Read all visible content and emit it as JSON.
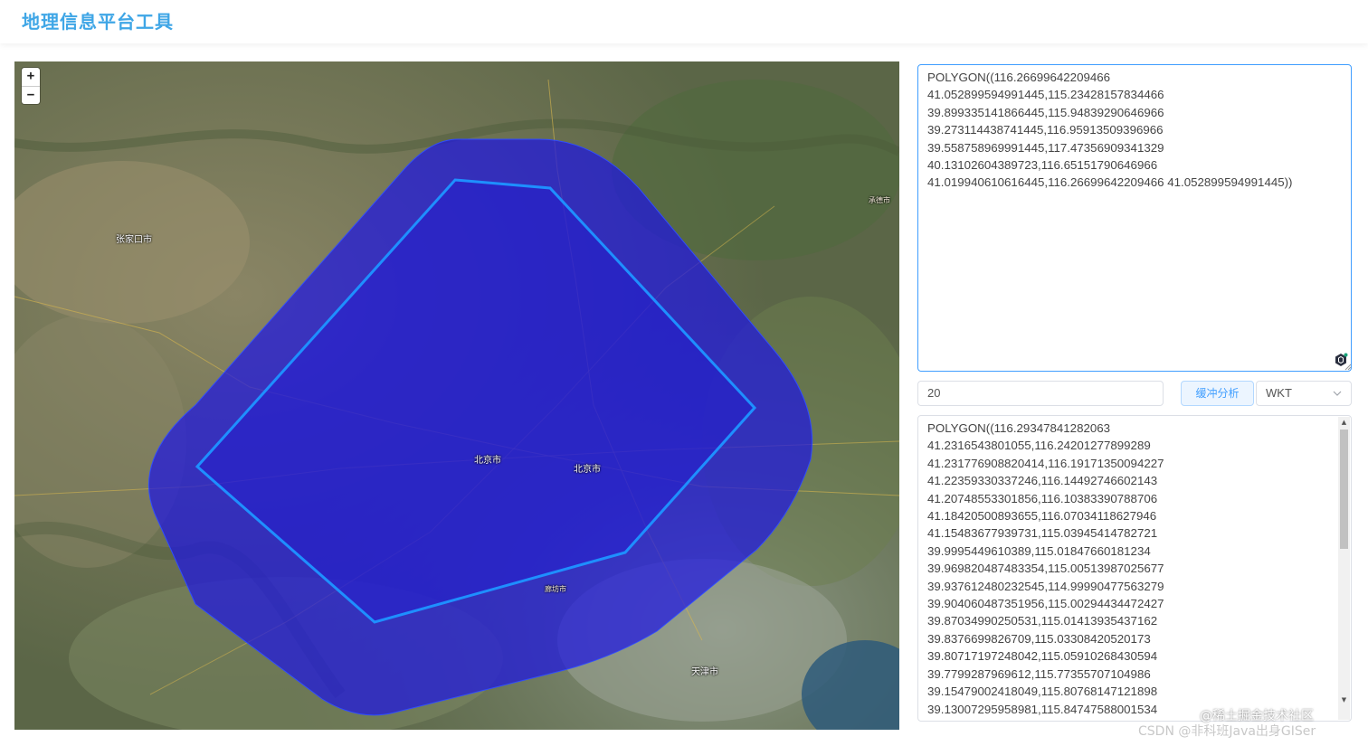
{
  "app": {
    "title": "地理信息平台工具"
  },
  "map": {
    "zoom_in_label": "+",
    "zoom_out_label": "−",
    "polygon_fill": "#1b12e6",
    "polygon_stroke": "#1e8fff",
    "labels": {
      "zhangjiakou": "张家口市",
      "beijing": "北京市",
      "tianjin": "天津市",
      "chengde": "承德市",
      "langfang": "廊坊市"
    }
  },
  "wkt_input": {
    "lines": [
      "POLYGON((116.26699642209466",
      "41.052899594991445,115.23428157834466",
      "39.899335141866445,115.94839290646966",
      "39.273114438741445,116.95913509396966",
      "39.558758969991445,117.47356909341329",
      "40.13102604389723,116.65151790646966",
      "41.019940610616445,116.26699642209466 41.052899594991445))"
    ]
  },
  "controls": {
    "distance_value": "20",
    "buffer_button_label": "缓冲分析",
    "format_value": "WKT"
  },
  "result_output": {
    "lines": [
      "POLYGON((116.29347841282063",
      "41.2316543801055,116.24201277899289",
      "41.231776908820414,116.19171350094227",
      "41.22359330337246,116.14492746602143",
      "41.20748553301856,116.10383390788706",
      "41.18420500893655,116.07034118627946",
      "41.15483677939731,115.03945414782721",
      "39.9995449610389,115.01847660181234",
      "39.969820487483354,115.00513987025677",
      "39.937612480232545,114.99990477563279",
      "39.904060487351956,115.00294434472427",
      "39.87034990250531,115.01413935437162",
      "39.8376699826709,115.03308420520173",
      "39.80717197248042,115.05910268430594",
      "39.7799287969612,115.77355707104986",
      "39.15479002418049,115.80768147121898",
      "39.13007295958981,115.84747588001534"
    ]
  },
  "watermarks": {
    "juejin": "@稀土掘金技术社区",
    "csdn": "CSDN @非科班Java出身GISer"
  }
}
